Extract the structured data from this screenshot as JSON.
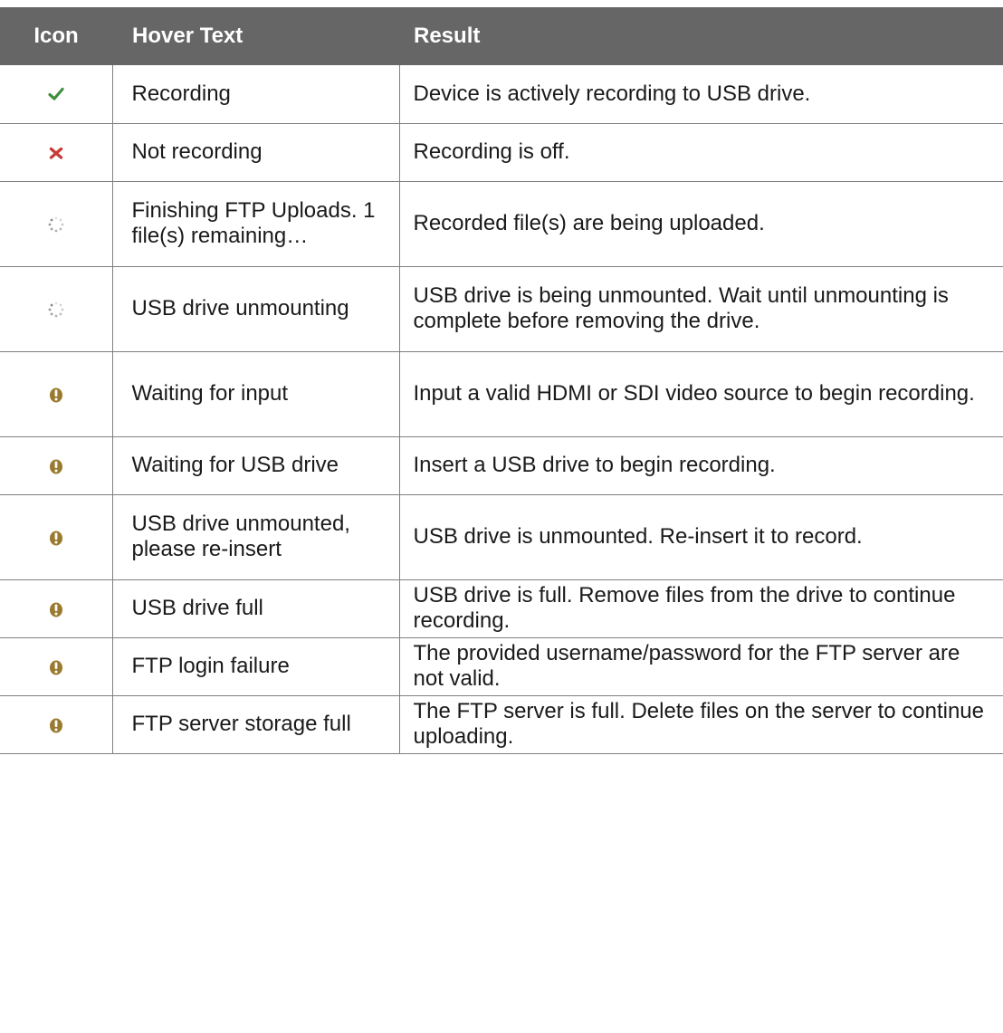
{
  "table": {
    "headers": {
      "icon": "Icon",
      "hover": "Hover Text",
      "result": "Result"
    },
    "rows": [
      {
        "icon": "check-icon",
        "hover": "Recording",
        "result": "Device is actively recording to USB drive."
      },
      {
        "icon": "x-icon",
        "hover": "Not recording",
        "result": "Recording is off."
      },
      {
        "icon": "spinner-icon",
        "hover": "Finishing FTP Uploads. 1 file(s) remaining…",
        "result": "Recorded file(s) are being uploaded."
      },
      {
        "icon": "spinner-icon",
        "hover": "USB drive unmounting",
        "result": "USB drive is being unmounted. Wait until unmounting is complete before removing the drive."
      },
      {
        "icon": "warning-icon",
        "hover": "Waiting for input",
        "result": "Input a valid HDMI or SDI video source to begin recording."
      },
      {
        "icon": "warning-icon",
        "hover": "Waiting for USB drive",
        "result": "Insert a USB drive to begin recording."
      },
      {
        "icon": "warning-icon",
        "hover": "USB drive unmounted, please re-insert",
        "result": "USB drive is unmounted. Re-insert it to record."
      },
      {
        "icon": "warning-icon",
        "hover": "USB drive full",
        "result": "USB drive is full. Remove files from the drive to continue recording."
      },
      {
        "icon": "warning-icon",
        "hover": "FTP login failure",
        "result": "The provided username/password for the FTP server are not valid."
      },
      {
        "icon": "warning-icon",
        "hover": "FTP server storage full",
        "result": "The FTP server is full. Delete files on the server to continue uploading."
      }
    ]
  },
  "colors": {
    "header_bg": "#666666",
    "header_text": "#ffffff",
    "check": "#3f8f3f",
    "x": "#c73a3a",
    "warning": "#9a7a2e",
    "spinner": "#8a8a8a"
  }
}
